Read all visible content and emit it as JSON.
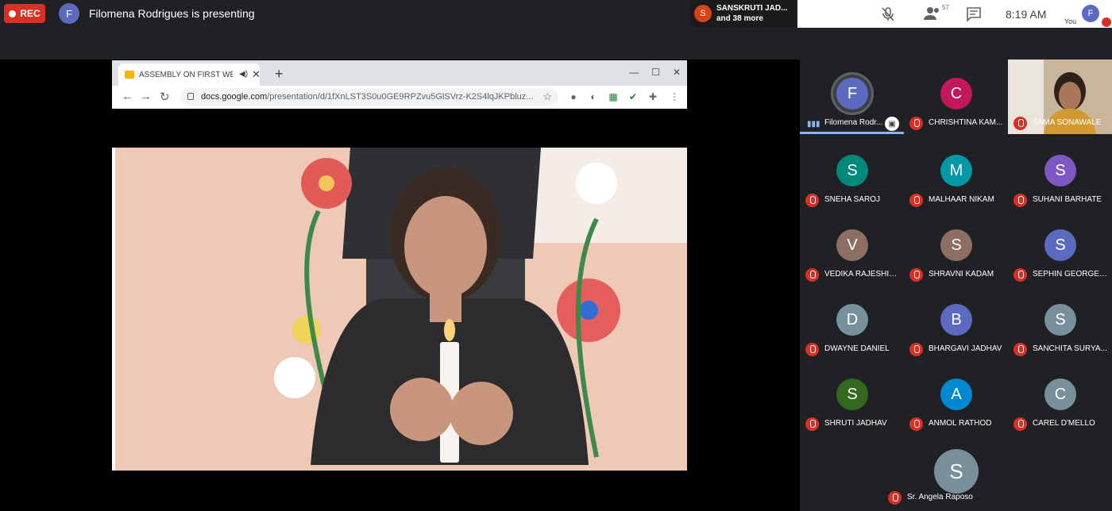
{
  "top": {
    "rec_label": "REC",
    "presenter_initial": "F",
    "presenting_text": "Filomena Rodrigues is presenting",
    "speaker_initial": "S",
    "speaker_name": "SANSKRUTI JAD...",
    "speaker_more": "and 38 more",
    "people_count": "57",
    "time": "8:19  AM",
    "you_label": "You",
    "you_initial": "F"
  },
  "browser": {
    "tab_title": "ASSEMBLY ON FIRST WEEK",
    "close_glyph": "✕",
    "new_tab_glyph": "+",
    "url_host": "docs.google.com",
    "url_path": "/presentation/d/1fXnLST3S0u0GE9RPZvu5GlSVrz-K2S4lqJKPbluz..."
  },
  "participants": [
    {
      "initial": "F",
      "name": "Filomena Rodr...",
      "color": "#5c6bc0",
      "active": true
    },
    {
      "initial": "C",
      "name": "CHRISHTINA KAM...",
      "color": "#c2185b"
    },
    {
      "initial": "",
      "name": "SAMA SONAWALE",
      "color": "#c9b59a",
      "video": true
    },
    {
      "initial": "S",
      "name": "SNEHA SAROJ",
      "color": "#00897b"
    },
    {
      "initial": "M",
      "name": "MALHAAR NIKAM",
      "color": "#0097a7"
    },
    {
      "initial": "S",
      "name": "SUHANI BARHATE",
      "color": "#7e57c2"
    },
    {
      "initial": "V",
      "name": "VEDIKA RAJESHIR...",
      "color": "#8d6e63"
    },
    {
      "initial": "S",
      "name": "SHRAVNI KADAM",
      "color": "#8d6e63"
    },
    {
      "initial": "S",
      "name": "SEPHIN GEORGE S...",
      "color": "#5c6bc0"
    },
    {
      "initial": "D",
      "name": "DWAYNE DANIEL",
      "color": "#78909c"
    },
    {
      "initial": "B",
      "name": "BHARGAVI JADHAV",
      "color": "#5c6bc0"
    },
    {
      "initial": "S",
      "name": "SANCHITA SURYA...",
      "color": "#78909c"
    },
    {
      "initial": "S",
      "name": "SHRUTI JADHAV",
      "color": "#33691e"
    },
    {
      "initial": "A",
      "name": "ANMOL RATHOD",
      "color": "#0288d1"
    },
    {
      "initial": "C",
      "name": "CAREL D'MELLO",
      "color": "#78909c"
    },
    {
      "initial": "S",
      "name": "Sr. Angela Raposo",
      "color": "#78909c"
    }
  ]
}
